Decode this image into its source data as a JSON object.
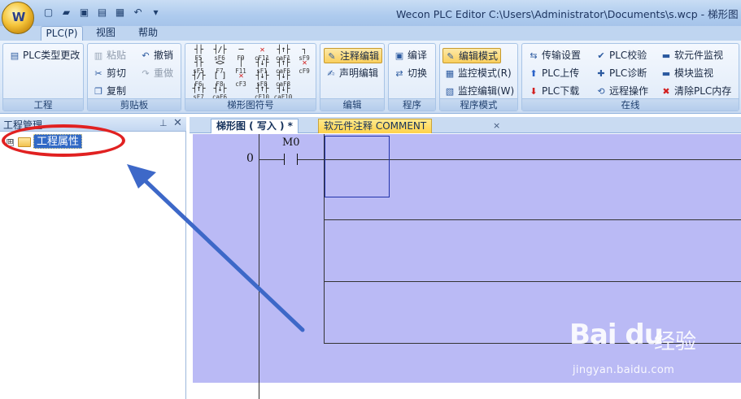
{
  "window": {
    "title": "Wecon PLC Editor  C:\\Users\\Administrator\\Documents\\s.wcp  - 梯形图"
  },
  "quick_access": [
    "new-file-icon",
    "open-folder-icon",
    "save-icon",
    "save-as-icon",
    "open-project-icon",
    "undo-arrow-icon",
    "dropdown-icon"
  ],
  "tabs": [
    {
      "label": "PLC(P)",
      "active": true
    },
    {
      "label": "视图",
      "active": false
    },
    {
      "label": "帮助",
      "active": false
    }
  ],
  "ribbon": {
    "project": {
      "label": "工程",
      "change_type": "PLC类型更改"
    },
    "clipboard": {
      "label": "剪贴板",
      "paste": "粘贴",
      "cut": "剪切",
      "copy": "复制",
      "undo": "撤销",
      "redo": "重做"
    },
    "ladder": {
      "label": "梯形图符号",
      "symbols": [
        {
          "glyph": "┤├",
          "label": "F5"
        },
        {
          "glyph": "┤/├",
          "label": "sF6"
        },
        {
          "glyph": "─",
          "label": "F9"
        },
        {
          "glyph": "✕",
          "label": "cF11"
        },
        {
          "glyph": "┤↑├",
          "label": "caF1"
        },
        {
          "glyph": "┐",
          "label": "sF9"
        },
        {
          "glyph": "┤├",
          "label": "sF5"
        },
        {
          "glyph": "<>",
          "label": "F7"
        },
        {
          "glyph": "│",
          "label": "F11"
        },
        {
          "glyph": "┤↓├",
          "label": "sF1"
        },
        {
          "glyph": "┤↑├",
          "label": "caF5"
        },
        {
          "glyph": "✕",
          "label": "cF9"
        },
        {
          "glyph": "┤/├",
          "label": "F6"
        },
        {
          "glyph": "[ ]",
          "label": "F8"
        },
        {
          "glyph": "✕",
          "label": "cF3"
        },
        {
          "glyph": "┤↓├",
          "label": "sF8"
        },
        {
          "glyph": "┤↓├",
          "label": "caF8"
        },
        {
          "glyph": "",
          "label": ""
        },
        {
          "glyph": "┤↑├",
          "label": "sF7"
        },
        {
          "glyph": "┤↓├",
          "label": "caF6"
        },
        {
          "glyph": "",
          "label": ""
        },
        {
          "glyph": "┤↑├",
          "label": "cF10"
        },
        {
          "glyph": "┤↓├",
          "label": "caF10"
        },
        {
          "glyph": "",
          "label": ""
        }
      ]
    },
    "edit": {
      "label": "编辑",
      "comment_edit": "注释编辑",
      "statement_edit": "声明编辑"
    },
    "program": {
      "label": "程序",
      "compile": "编译",
      "switch": "切换"
    },
    "program_mode": {
      "label": "程序模式",
      "edit_mode": "编辑模式",
      "monitor_mode": "监控模式(R)",
      "monitor_edit": "监控编辑(W)"
    },
    "online": {
      "label": "在线",
      "transfer_settings": "传输设置",
      "plc_upload": "PLC上传",
      "plc_download": "PLC下载",
      "plc_verify": "PLC校验",
      "plc_diagnose": "PLC诊断",
      "remote_operation": "远程操作",
      "device_monitor": "软元件监视",
      "module_monitor": "模块监视",
      "clear_plc_memory": "清除PLC内存"
    }
  },
  "project_panel": {
    "title": "工程管理",
    "tree": [
      {
        "label": "工程属性",
        "expand": "⊞"
      }
    ]
  },
  "editor": {
    "tabs": [
      {
        "label": "梯形图 ( 写入 ) *",
        "active": true
      },
      {
        "label": "软元件注释 COMMENT",
        "active": false
      }
    ],
    "close": "×",
    "ladder": {
      "step": "0",
      "contact": "M0"
    }
  },
  "watermark": {
    "logo": "Bai du",
    "product": "经验",
    "url": "jingyan.baidu.com"
  },
  "colors": {
    "ladder_background": "#babaf5",
    "selection": "#3169c6",
    "annotation_red": "#e12121",
    "annotation_blue": "#3d68c8"
  }
}
